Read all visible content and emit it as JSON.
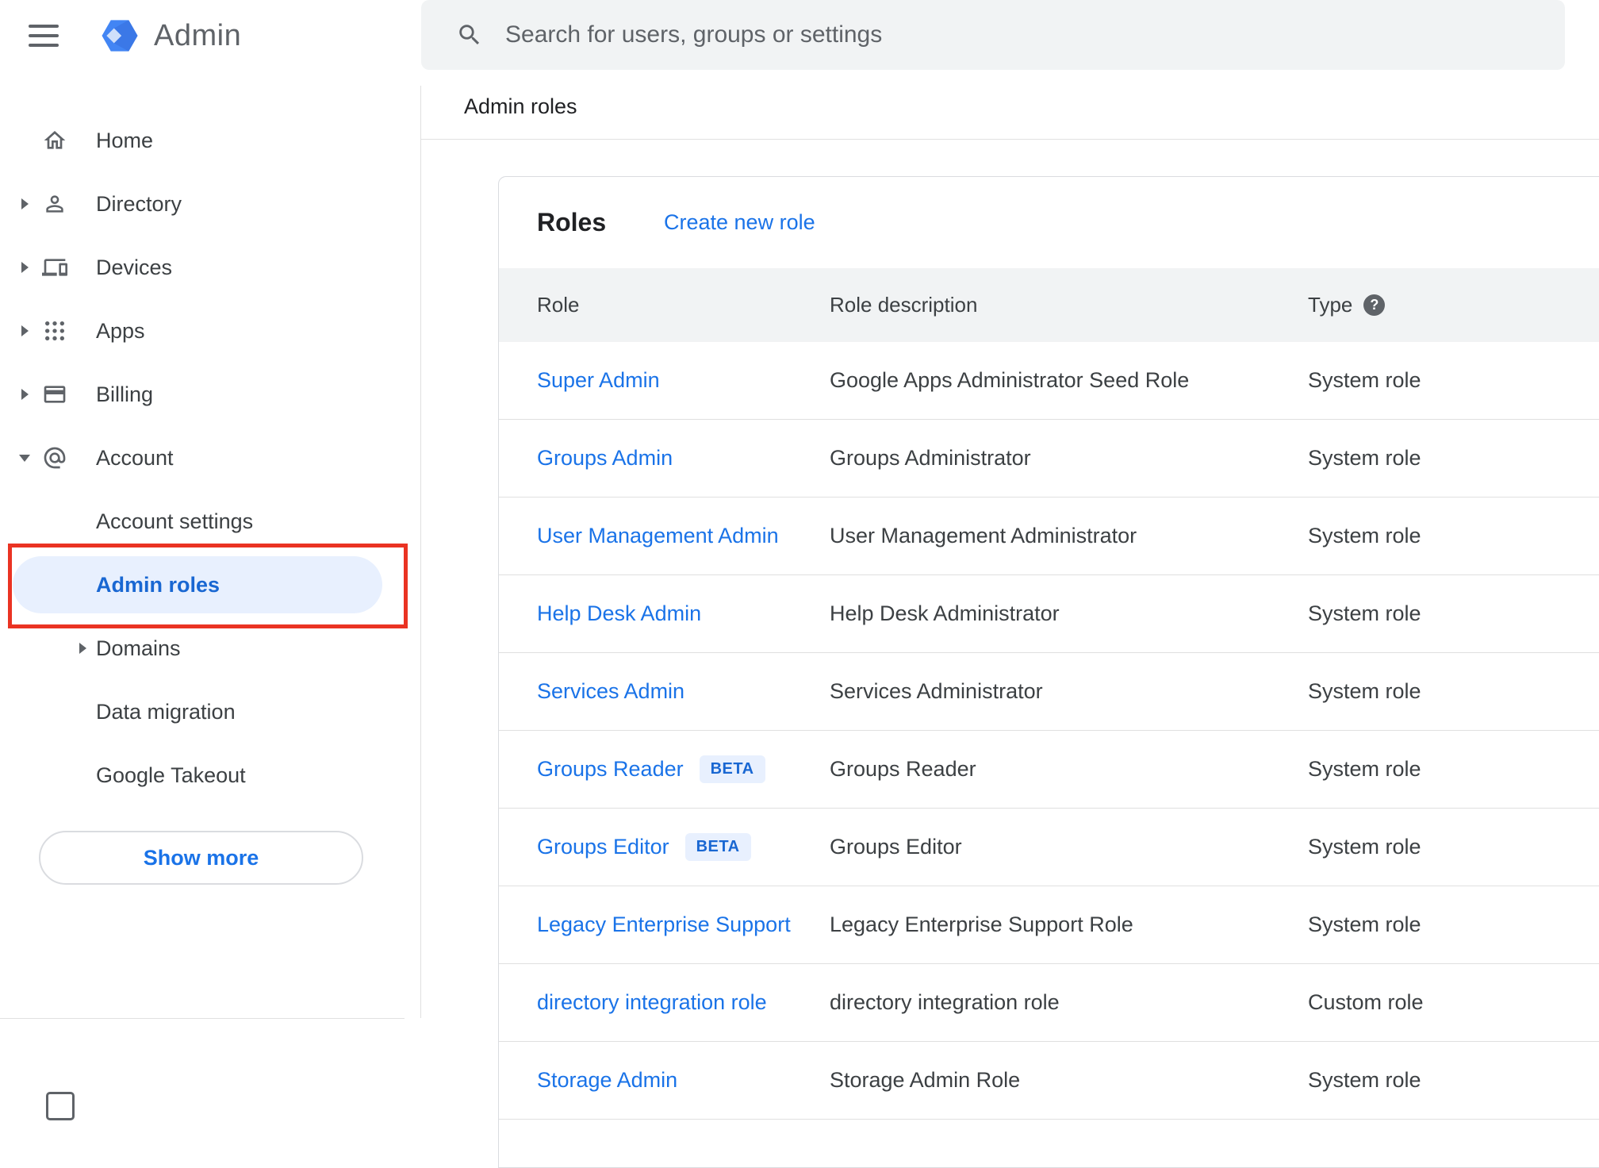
{
  "colors": {
    "accent": "#1a73e8",
    "selected_text": "#1967d2",
    "selected_bg": "#e8f0fe",
    "annotation_red": "#ea3323"
  },
  "header": {
    "logo_text": "Admin",
    "search_placeholder": "Search for users, groups or settings"
  },
  "breadcrumb": "Admin roles",
  "icons": {
    "help_glyph": "?"
  },
  "sidebar": {
    "items": [
      {
        "label": "Home",
        "expand": "none"
      },
      {
        "label": "Directory",
        "expand": "collapsed"
      },
      {
        "label": "Devices",
        "expand": "collapsed"
      },
      {
        "label": "Apps",
        "expand": "collapsed"
      },
      {
        "label": "Billing",
        "expand": "collapsed"
      },
      {
        "label": "Account",
        "expand": "expanded"
      }
    ],
    "account_subitems": [
      {
        "label": "Account settings",
        "selected": false
      },
      {
        "label": "Admin roles",
        "selected": true
      },
      {
        "label": "Domains",
        "expand": "collapsed"
      },
      {
        "label": "Data migration"
      },
      {
        "label": "Google Takeout"
      }
    ],
    "show_more_label": "Show more"
  },
  "roles": {
    "title": "Roles",
    "create_link": "Create new role",
    "columns": [
      "Role",
      "Role description",
      "Type"
    ],
    "beta_label": "BETA",
    "rows": [
      {
        "role": "Super Admin",
        "beta": false,
        "description": "Google Apps Administrator Seed Role",
        "type": "System role"
      },
      {
        "role": "Groups Admin",
        "beta": false,
        "description": "Groups Administrator",
        "type": "System role"
      },
      {
        "role": "User Management Admin",
        "beta": false,
        "description": "User Management Administrator",
        "type": "System role"
      },
      {
        "role": "Help Desk Admin",
        "beta": false,
        "description": "Help Desk Administrator",
        "type": "System role"
      },
      {
        "role": "Services Admin",
        "beta": false,
        "description": "Services Administrator",
        "type": "System role"
      },
      {
        "role": "Groups Reader",
        "beta": true,
        "description": "Groups Reader",
        "type": "System role"
      },
      {
        "role": "Groups Editor",
        "beta": true,
        "description": "Groups Editor",
        "type": "System role"
      },
      {
        "role": "Legacy Enterprise Support",
        "beta": false,
        "description": "Legacy Enterprise Support Role",
        "type": "System role"
      },
      {
        "role": "directory integration role",
        "beta": false,
        "description": "directory integration role",
        "type": "Custom role"
      },
      {
        "role": "Storage Admin",
        "beta": false,
        "description": "Storage Admin Role",
        "type": "System role"
      }
    ]
  }
}
